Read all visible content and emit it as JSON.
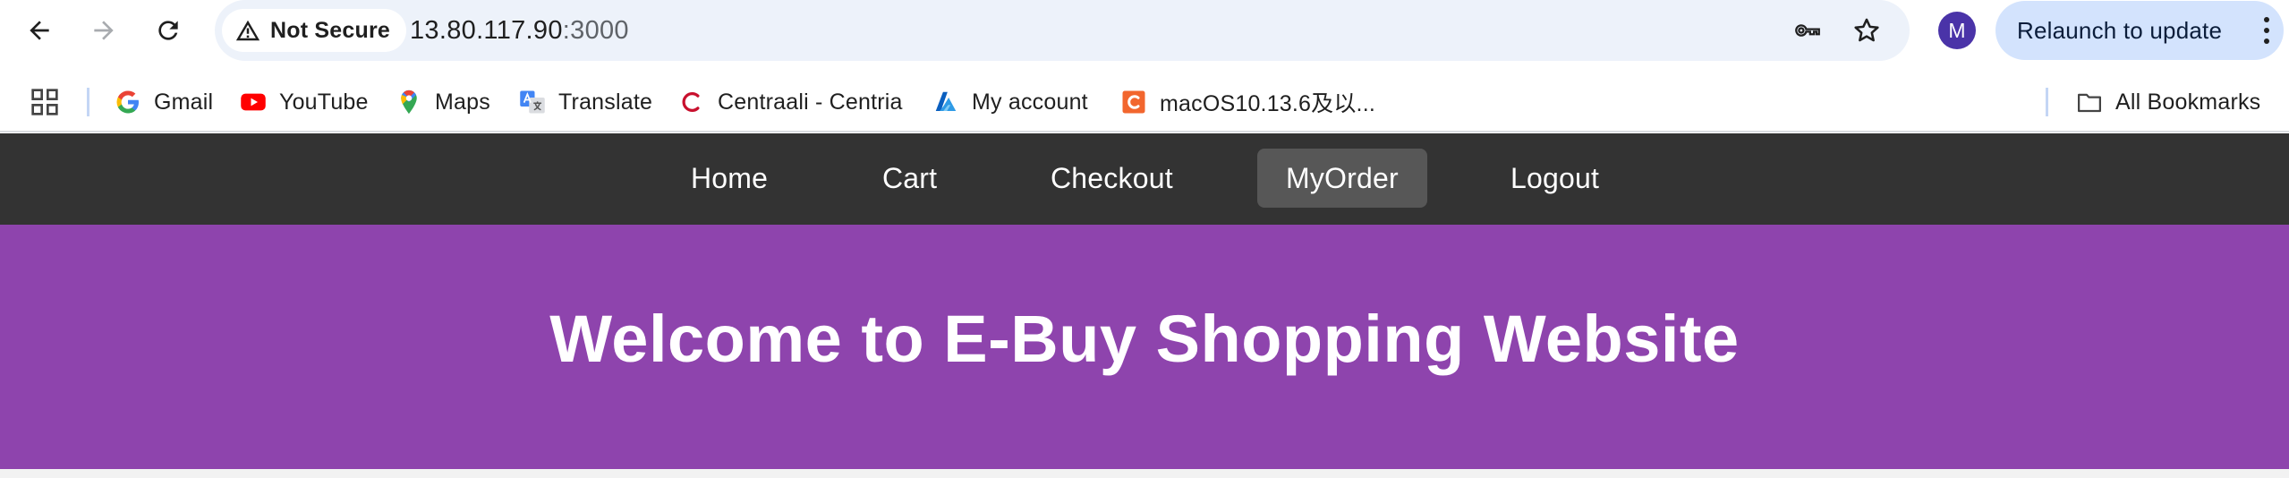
{
  "browser": {
    "security_label": "Not Secure",
    "url_host": "13.80.117.90",
    "url_port": ":3000",
    "profile_initial": "M",
    "relaunch_label": "Relaunch to update"
  },
  "bookmarks": [
    {
      "label": "Gmail",
      "icon": "google-icon"
    },
    {
      "label": "YouTube",
      "icon": "youtube-icon"
    },
    {
      "label": "Maps",
      "icon": "maps-pin-icon"
    },
    {
      "label": "Translate",
      "icon": "translate-icon"
    },
    {
      "label": "Centraali - Centria",
      "icon": "centria-icon"
    },
    {
      "label": "My account",
      "icon": "azure-icon"
    },
    {
      "label": "macOS10.13.6及以...",
      "icon": "c-logo-icon"
    }
  ],
  "all_bookmarks_label": "All Bookmarks",
  "site": {
    "nav": [
      "Home",
      "Cart",
      "Checkout",
      "MyOrder",
      "Logout"
    ],
    "active_nav": "MyOrder",
    "hero_title": "Welcome to E-Buy Shopping Website",
    "colors": {
      "nav_bg": "#333333",
      "nav_active": "#575757",
      "hero_bg": "#8e44ad"
    }
  }
}
